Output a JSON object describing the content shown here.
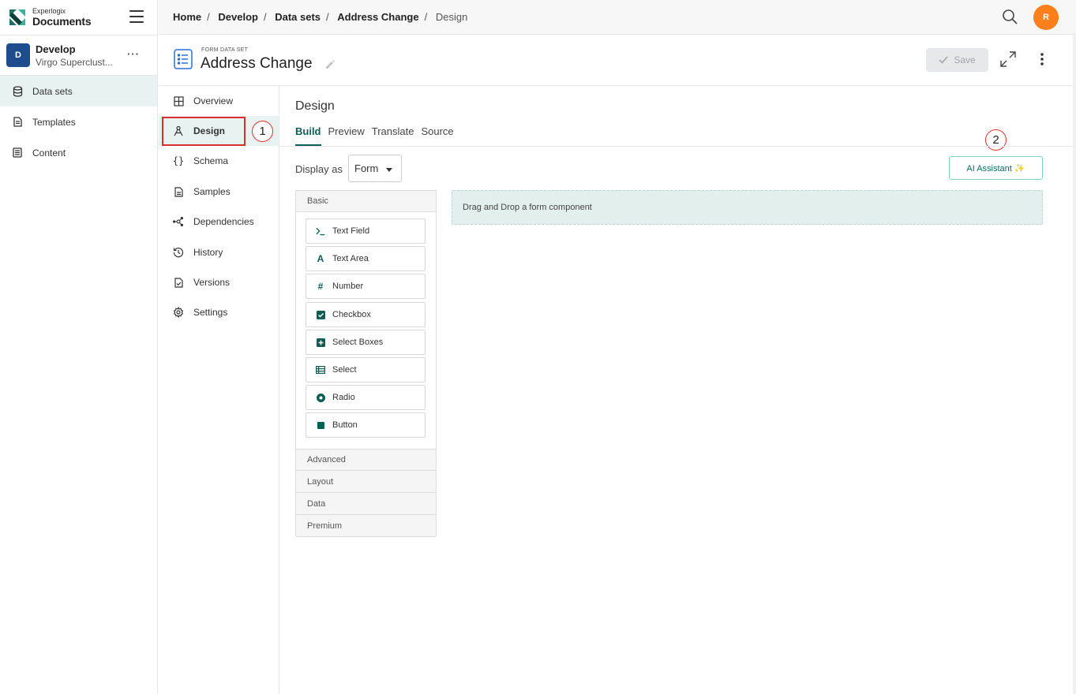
{
  "brand": {
    "small": "Experlogix",
    "big": "Documents"
  },
  "workspace": {
    "initial": "D",
    "name": "Develop",
    "subtitle": "Virgo Superclust...",
    "more": "···"
  },
  "sidebar": {
    "items": [
      {
        "label": "Data sets",
        "icon": "database-icon"
      },
      {
        "label": "Templates",
        "icon": "document-icon"
      },
      {
        "label": "Content",
        "icon": "content-icon"
      }
    ]
  },
  "breadcrumb": [
    "Home",
    "Develop",
    "Data sets",
    "Address Change",
    "Design"
  ],
  "user": {
    "initial": "R",
    "color": "#ff7f1a"
  },
  "title": {
    "kicker": "FORM DATA SET",
    "name": "Address Change",
    "save_label": "Save"
  },
  "subnav": {
    "items": [
      {
        "label": "Overview",
        "icon": "grid-icon"
      },
      {
        "label": "Design",
        "icon": "design-icon"
      },
      {
        "label": "Schema",
        "icon": "braces-icon"
      },
      {
        "label": "Samples",
        "icon": "file-icon"
      },
      {
        "label": "Dependencies",
        "icon": "network-icon"
      },
      {
        "label": "History",
        "icon": "history-icon"
      },
      {
        "label": "Versions",
        "icon": "version-icon"
      },
      {
        "label": "Settings",
        "icon": "gear-icon"
      }
    ]
  },
  "markers": [
    "1",
    "2"
  ],
  "main": {
    "title": "Design",
    "tabs": [
      "Build",
      "Preview",
      "Translate",
      "Source"
    ],
    "display_label": "Display as",
    "display_value": "Form",
    "ai_label": "AI Assistant ✨",
    "dropzone": "Drag and Drop a form component"
  },
  "palette": {
    "basic": "Basic",
    "components": [
      {
        "label": "Text Field",
        "icon": "terminal-icon"
      },
      {
        "label": "Text Area",
        "icon": "font-icon"
      },
      {
        "label": "Number",
        "icon": "hash-icon"
      },
      {
        "label": "Checkbox",
        "icon": "checkbox-icon"
      },
      {
        "label": "Select Boxes",
        "icon": "plus-square-icon"
      },
      {
        "label": "Select",
        "icon": "list-icon"
      },
      {
        "label": "Radio",
        "icon": "radio-icon"
      },
      {
        "label": "Button",
        "icon": "stop-icon"
      }
    ],
    "sections": [
      "Advanced",
      "Layout",
      "Data",
      "Premium"
    ]
  },
  "colors": {
    "accent": "#0c5d54",
    "active_bg": "#e8f3f1",
    "highlight": "#d9302f"
  }
}
